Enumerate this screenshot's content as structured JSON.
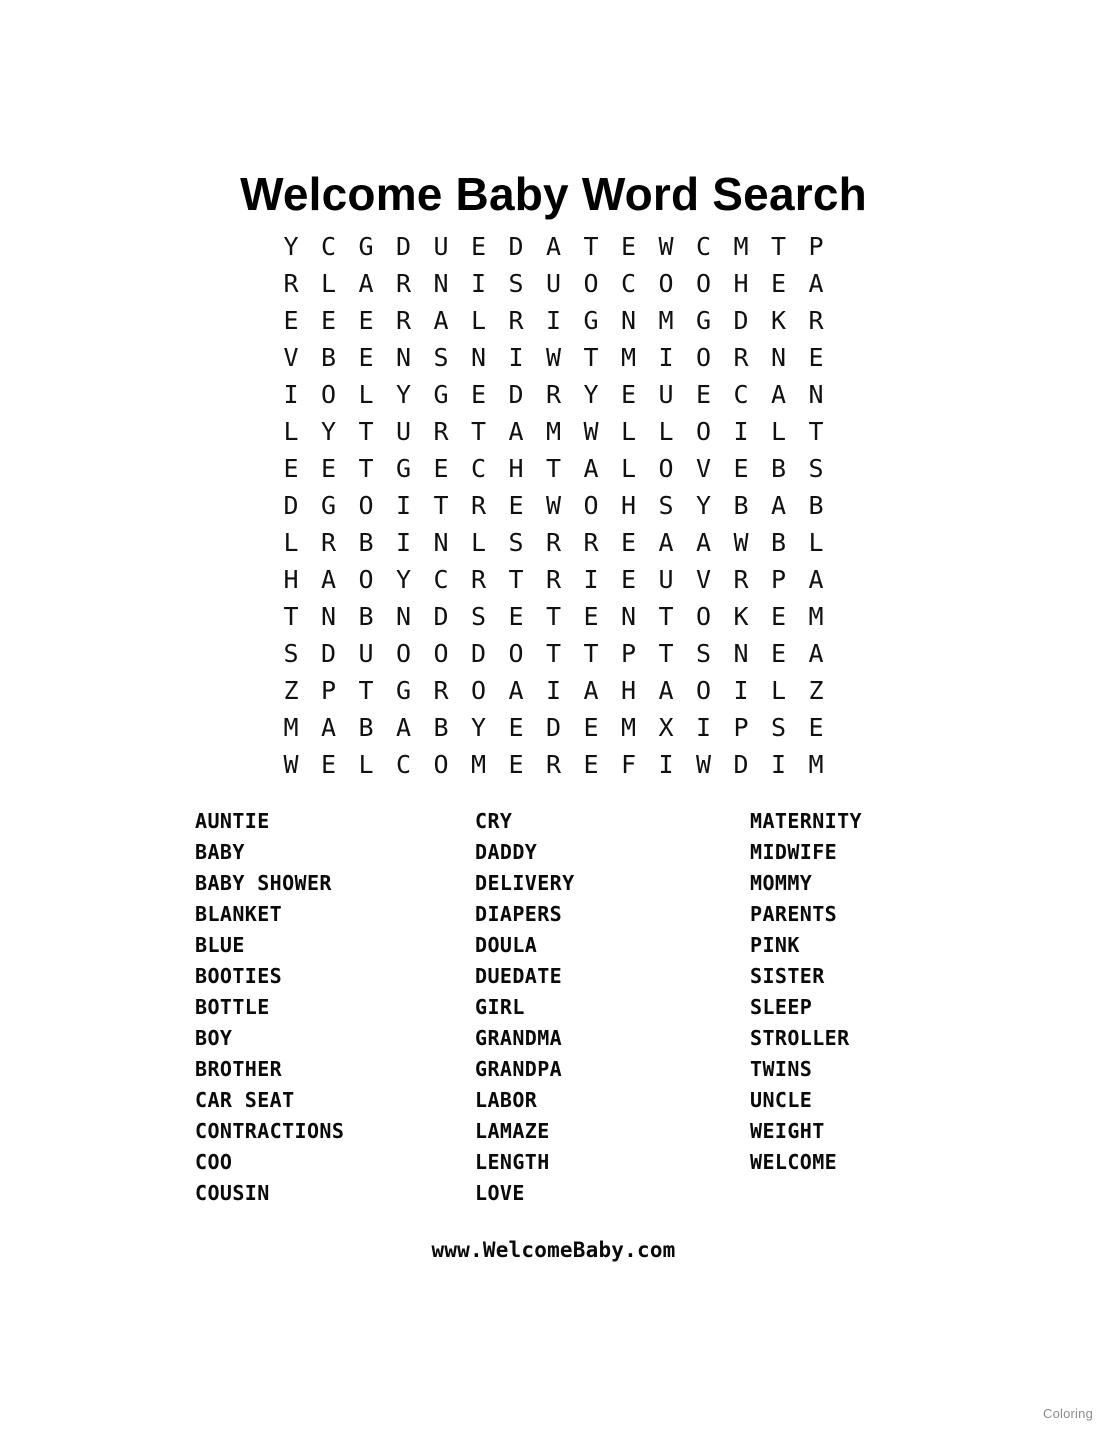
{
  "page": {
    "title": "Welcome Baby Word Search",
    "footer_url": "www.WelcomeBaby.com",
    "watermark": "Coloring",
    "background_color": "#ffffff",
    "text_color": "#000000"
  },
  "puzzle": {
    "rows": 15,
    "columns": 16,
    "grid": [
      [
        "Y",
        "C",
        "G",
        "D",
        "U",
        "E",
        "D",
        "A",
        "T",
        "E",
        "W",
        "C",
        "M",
        "T",
        "P"
      ],
      [
        "R",
        "L",
        "A",
        "R",
        "N",
        "I",
        "S",
        "U",
        "O",
        "C",
        "O",
        "O",
        "H",
        "E",
        "A"
      ],
      [
        "E",
        "E",
        "E",
        "R",
        "A",
        "L",
        "R",
        "I",
        "G",
        "N",
        "M",
        "G",
        "D",
        "K",
        "R"
      ],
      [
        "V",
        "B",
        "E",
        "N",
        "S",
        "N",
        "I",
        "W",
        "T",
        "M",
        "I",
        "O",
        "R",
        "N",
        "E"
      ],
      [
        "I",
        "O",
        "L",
        "Y",
        "G",
        "E",
        "D",
        "R",
        "Y",
        "E",
        "U",
        "E",
        "C",
        "A",
        "N"
      ],
      [
        "L",
        "Y",
        "T",
        "U",
        "R",
        "T",
        "A",
        "M",
        "W",
        "L",
        "L",
        "O",
        "I",
        "L",
        "T"
      ],
      [
        "E",
        "E",
        "T",
        "G",
        "E",
        "C",
        "H",
        "T",
        "A",
        "L",
        "O",
        "V",
        "E",
        "B",
        "S"
      ],
      [
        "D",
        "G",
        "O",
        "I",
        "T",
        "R",
        "E",
        "W",
        "O",
        "H",
        "S",
        "Y",
        "B",
        "A",
        "B"
      ],
      [
        "L",
        "R",
        "B",
        "I",
        "N",
        "L",
        "S",
        "R",
        "R",
        "E",
        "A",
        "A",
        "W",
        "B",
        "L"
      ],
      [
        "H",
        "A",
        "O",
        "Y",
        "C",
        "R",
        "T",
        "R",
        "I",
        "E",
        "U",
        "V",
        "R",
        "P",
        "A"
      ],
      [
        "T",
        "N",
        "B",
        "N",
        "D",
        "S",
        "E",
        "T",
        "E",
        "N",
        "T",
        "O",
        "K",
        "E",
        "M"
      ],
      [
        "S",
        "D",
        "U",
        "O",
        "O",
        "D",
        "O",
        "T",
        "T",
        "P",
        "T",
        "S",
        "N",
        "E",
        "A"
      ],
      [
        "Z",
        "P",
        "T",
        "G",
        "R",
        "O",
        "A",
        "I",
        "A",
        "H",
        "A",
        "O",
        "I",
        "L",
        "Z"
      ],
      [
        "M",
        "A",
        "B",
        "A",
        "B",
        "Y",
        "E",
        "D",
        "E",
        "M",
        "X",
        "I",
        "P",
        "S",
        "E"
      ],
      [
        "W",
        "E",
        "L",
        "C",
        "O",
        "M",
        "E",
        "R",
        "E",
        "F",
        "I",
        "W",
        "D",
        "I",
        "M"
      ]
    ]
  },
  "word_list": {
    "columns": [
      {
        "words": [
          "AUNTIE",
          "BABY",
          "BABY SHOWER",
          "BLANKET",
          "BLUE",
          "BOOTIES",
          "BOTTLE",
          "BOY",
          "BROTHER",
          "CAR SEAT",
          "CONTRACTIONS",
          "COO",
          "COUSIN"
        ]
      },
      {
        "words": [
          "CRY",
          "DADDY",
          "DELIVERY",
          "DIAPERS",
          "DOULA",
          "DUEDATE",
          "GIRL",
          "GRANDMA",
          "GRANDPA",
          "LABOR",
          "LAMAZE",
          "LENGTH",
          "LOVE"
        ]
      },
      {
        "words": [
          "MATERNITY",
          "MIDWIFE",
          "MOMMY",
          "PARENTS",
          "PINK",
          "SISTER",
          "SLEEP",
          "STROLLER",
          "TWINS",
          "UNCLE",
          "WEIGHT",
          "WELCOME"
        ]
      }
    ]
  }
}
